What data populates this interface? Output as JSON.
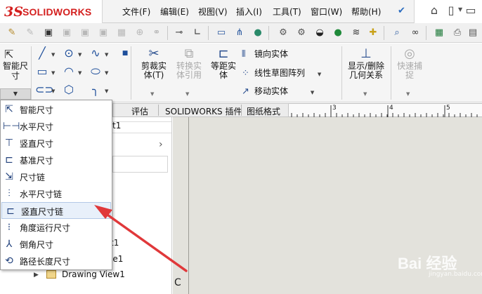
{
  "app": {
    "logo_ds": "3S",
    "logo_text": "SOLIDWORKS"
  },
  "menubar": {
    "items": [
      "文件(F)",
      "编辑(E)",
      "视图(V)",
      "插入(I)",
      "工具(T)",
      "窗口(W)",
      "帮助(H)"
    ]
  },
  "ribbon": {
    "smart_dim_label": "智能尺寸",
    "trim_label": "剪裁实体(T)",
    "convert_label": "转换实体引用",
    "offset_label": "等距实体",
    "mirror_label": "镜向实体",
    "linear_pattern_label": "线性草图阵列",
    "move_label": "移动实体",
    "display_relations_label": "显示/删除几何关系",
    "quick_snap_label": "快速捕捉"
  },
  "tabs": [
    "评估",
    "SOLIDWORKS 插件",
    "图纸格式"
  ],
  "ruler": {
    "numbers": [
      "3",
      "4",
      "5"
    ]
  },
  "dimension_menu": {
    "items": [
      {
        "label": "智能尺寸",
        "icon": "smart-dimension-icon"
      },
      {
        "label": "水平尺寸",
        "icon": "horizontal-dimension-icon"
      },
      {
        "label": "竖直尺寸",
        "icon": "vertical-dimension-icon"
      },
      {
        "label": "基准尺寸",
        "icon": "baseline-dimension-icon"
      },
      {
        "label": "尺寸链",
        "icon": "ordinate-dimension-icon"
      },
      {
        "label": "水平尺寸链",
        "icon": "horizontal-ordinate-icon"
      },
      {
        "label": "竖直尺寸链",
        "icon": "vertical-ordinate-icon"
      },
      {
        "label": "角度运行尺寸",
        "icon": "angular-running-icon"
      },
      {
        "label": "倒角尺寸",
        "icon": "chamfer-dimension-icon"
      },
      {
        "label": "路径长度尺寸",
        "icon": "path-length-icon"
      }
    ],
    "highlighted_index": 6
  },
  "tree": {
    "partial_1": "t1",
    "partial_2": "le1",
    "drawing_view": "Drawing View1"
  },
  "watermark": {
    "text": "Bai 经验",
    "sub": "jingyan.baidu.com"
  },
  "colors": {
    "accent": "#d4201f",
    "arrow": "#e0383a",
    "canvas": "#e3e2dc",
    "highlight": "#e8f0fa"
  }
}
